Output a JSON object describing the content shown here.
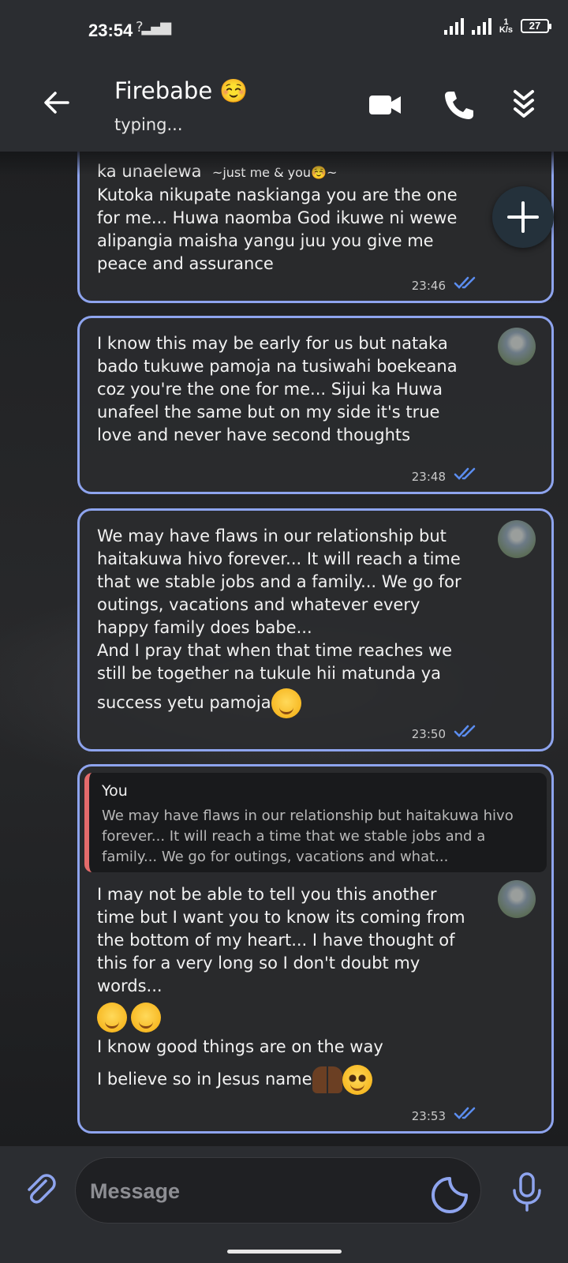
{
  "status_bar": {
    "time": "23:54",
    "net_speed": "1\nK/s",
    "net_type": "3G",
    "battery": "27"
  },
  "header": {
    "contact_name": "Firebabe ☺️",
    "status": "typing...",
    "icons": [
      "back-arrow-icon",
      "video-call-icon",
      "phone-icon",
      "chevrons-down-icon"
    ]
  },
  "messages": [
    {
      "text_prefix": "ka unaelewa",
      "text_prefix_small": "~just me & you☺️~",
      "text": "Kutoka nikupate naskianga you are the one for me... Huwa naomba God ikuwe ni wewe alipangia maisha yangu juu you give me peace and assurance",
      "time": "23:46"
    },
    {
      "text": "I know this may be early for us but nataka bado tukuwe pamoja na tusiwahi boekeana coz you're the one for me... Sijui ka Huwa unafeel the same but on my side it's true love and never have second thoughts",
      "time": "23:48"
    },
    {
      "text": "We may have flaws in our relationship but haitakuwa hivo forever... It will reach a time that we stable jobs and a family... We go for outings, vacations and whatever every happy family does babe...\nAnd I pray that when that time reaches we still be together na tukule hii matunda ya",
      "text_last": "success yetu pamoja",
      "time": "23:50"
    },
    {
      "quote_author": "You",
      "quote_text": "We may have flaws in our relationship but haitakuwa hivo forever... It will reach a time that we stable jobs and a family... We go for outings, vacations and what...",
      "text": "I may not be able to tell you this another time but I want you to know its coming from the bottom of my heart... I have thought of this for a very long so I don't doubt my words...",
      "line2": "I know good things are on the way",
      "line3": "I believe so in Jesus name",
      "time": "23:53"
    }
  ],
  "composer": {
    "placeholder": "Message"
  },
  "colors": {
    "bubble_border": "#8ea4ee",
    "tick_blue": "#5b8def",
    "quote_bar": "#e46b6b",
    "header_bg": "#2b2d31"
  }
}
